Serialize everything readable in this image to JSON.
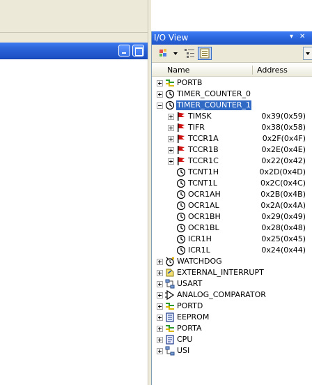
{
  "panel": {
    "title": "I/O View",
    "pin_glyph": "▾",
    "close_glyph": "✕",
    "col_name": "Name",
    "col_address": "Address"
  },
  "tree": [
    {
      "label": "PORTB",
      "icon": "port-icon",
      "level": 0,
      "expander": "plus",
      "address": ""
    },
    {
      "label": "TIMER_COUNTER_0",
      "icon": "timer-icon",
      "level": 0,
      "expander": "plus",
      "address": ""
    },
    {
      "label": "TIMER_COUNTER_1",
      "icon": "timer-icon",
      "level": 0,
      "expander": "minus",
      "address": "",
      "selected": true
    },
    {
      "label": "TIMSK",
      "icon": "flag-icon",
      "level": 1,
      "expander": "plus",
      "address": "0x39(0x59)"
    },
    {
      "label": "TIFR",
      "icon": "flag-icon",
      "level": 1,
      "expander": "plus",
      "address": "0x38(0x58)"
    },
    {
      "label": "TCCR1A",
      "icon": "flag-icon",
      "level": 1,
      "expander": "plus",
      "address": "0x2F(0x4F)"
    },
    {
      "label": "TCCR1B",
      "icon": "flag-icon",
      "level": 1,
      "expander": "plus",
      "address": "0x2E(0x4E)"
    },
    {
      "label": "TCCR1C",
      "icon": "flag-icon",
      "level": 1,
      "expander": "plus",
      "address": "0x22(0x42)"
    },
    {
      "label": "TCNT1H",
      "icon": "timer-icon",
      "level": 1,
      "expander": "none",
      "address": "0x2D(0x4D)"
    },
    {
      "label": "TCNT1L",
      "icon": "timer-icon",
      "level": 1,
      "expander": "none",
      "address": "0x2C(0x4C)"
    },
    {
      "label": "OCR1AH",
      "icon": "timer-icon",
      "level": 1,
      "expander": "none",
      "address": "0x2B(0x4B)"
    },
    {
      "label": "OCR1AL",
      "icon": "timer-icon",
      "level": 1,
      "expander": "none",
      "address": "0x2A(0x4A)"
    },
    {
      "label": "OCR1BH",
      "icon": "timer-icon",
      "level": 1,
      "expander": "none",
      "address": "0x29(0x49)"
    },
    {
      "label": "OCR1BL",
      "icon": "timer-icon",
      "level": 1,
      "expander": "none",
      "address": "0x28(0x48)"
    },
    {
      "label": "ICR1H",
      "icon": "timer-icon",
      "level": 1,
      "expander": "none",
      "address": "0x25(0x45)"
    },
    {
      "label": "ICR1L",
      "icon": "timer-icon",
      "level": 1,
      "expander": "none",
      "address": "0x24(0x44)"
    },
    {
      "label": "WATCHDOG",
      "icon": "watchdog-icon",
      "level": 0,
      "expander": "plus",
      "address": ""
    },
    {
      "label": "EXTERNAL_INTERRUPT",
      "icon": "interrupt-icon",
      "level": 0,
      "expander": "plus",
      "address": ""
    },
    {
      "label": "USART",
      "icon": "usart-icon",
      "level": 0,
      "expander": "plus",
      "address": ""
    },
    {
      "label": "ANALOG_COMPARATOR",
      "icon": "comparator-icon",
      "level": 0,
      "expander": "plus",
      "address": ""
    },
    {
      "label": "PORTD",
      "icon": "port-icon",
      "level": 0,
      "expander": "plus",
      "address": ""
    },
    {
      "label": "EEPROM",
      "icon": "eeprom-icon",
      "level": 0,
      "expander": "plus",
      "address": ""
    },
    {
      "label": "PORTA",
      "icon": "port-icon",
      "level": 0,
      "expander": "plus",
      "address": ""
    },
    {
      "label": "CPU",
      "icon": "cpu-icon",
      "level": 0,
      "expander": "plus",
      "address": ""
    },
    {
      "label": "USI",
      "icon": "usi-icon",
      "level": 0,
      "expander": "plus",
      "address": ""
    }
  ],
  "colors": {
    "titlebar": "#2b66dd",
    "selection": "#316ac5",
    "chrome": "#ece9d8"
  }
}
